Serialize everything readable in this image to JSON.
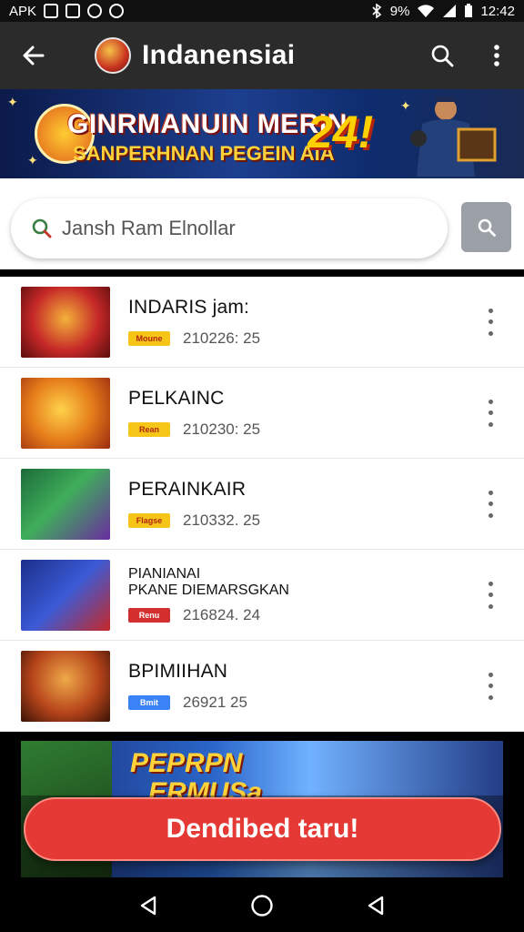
{
  "status_bar": {
    "left_text": "APK",
    "battery": "9%",
    "time": "12:42"
  },
  "app_bar": {
    "title": "Indanensiai",
    "icons": [
      "back-arrow-icon",
      "app-logo",
      "search-icon",
      "more-vert-icon"
    ]
  },
  "banner": {
    "line1": "GINRMANUIN MERIN",
    "line2": "SANPERHNAN PEGEIN  AIA",
    "number": "24!"
  },
  "search": {
    "placeholder": "Jansh Ram Elnollar"
  },
  "list": [
    {
      "name": "INDARIS jam:",
      "name2": "",
      "tag": "Moune",
      "tag_color": "#f5c518",
      "tag_text_color": "#b3260c",
      "date": "210226: 25"
    },
    {
      "name": "PELKAINC",
      "name2": "",
      "tag": "Rean",
      "tag_color": "#f5c518",
      "tag_text_color": "#b3260c",
      "date": "210230: 25"
    },
    {
      "name": "PERAINKAIR",
      "name2": "",
      "tag": "Flagse",
      "tag_color": "#f5c518",
      "tag_text_color": "#b3260c",
      "date": "210332. 25"
    },
    {
      "name": "PIANIANAI",
      "name2": "PKANE DIEMARSGKAN",
      "tag": "Renu",
      "tag_color": "#d32f2f",
      "tag_text_color": "#ffffff",
      "date": "216824. 24"
    },
    {
      "name": "BPIMIIHAN",
      "name2": "",
      "tag": "Bmit",
      "tag_color": "#3b82f6",
      "tag_text_color": "#ffffff",
      "date": "26921 25"
    }
  ],
  "promo": {
    "title1": "PEPRPN",
    "title2": "ERMUSa"
  },
  "cta_label": "Dendibed taru!",
  "colors": {
    "app_bar_bg": "#2b2b2b",
    "cta_red": "#e53935",
    "accent_yellow": "#f5c518"
  }
}
